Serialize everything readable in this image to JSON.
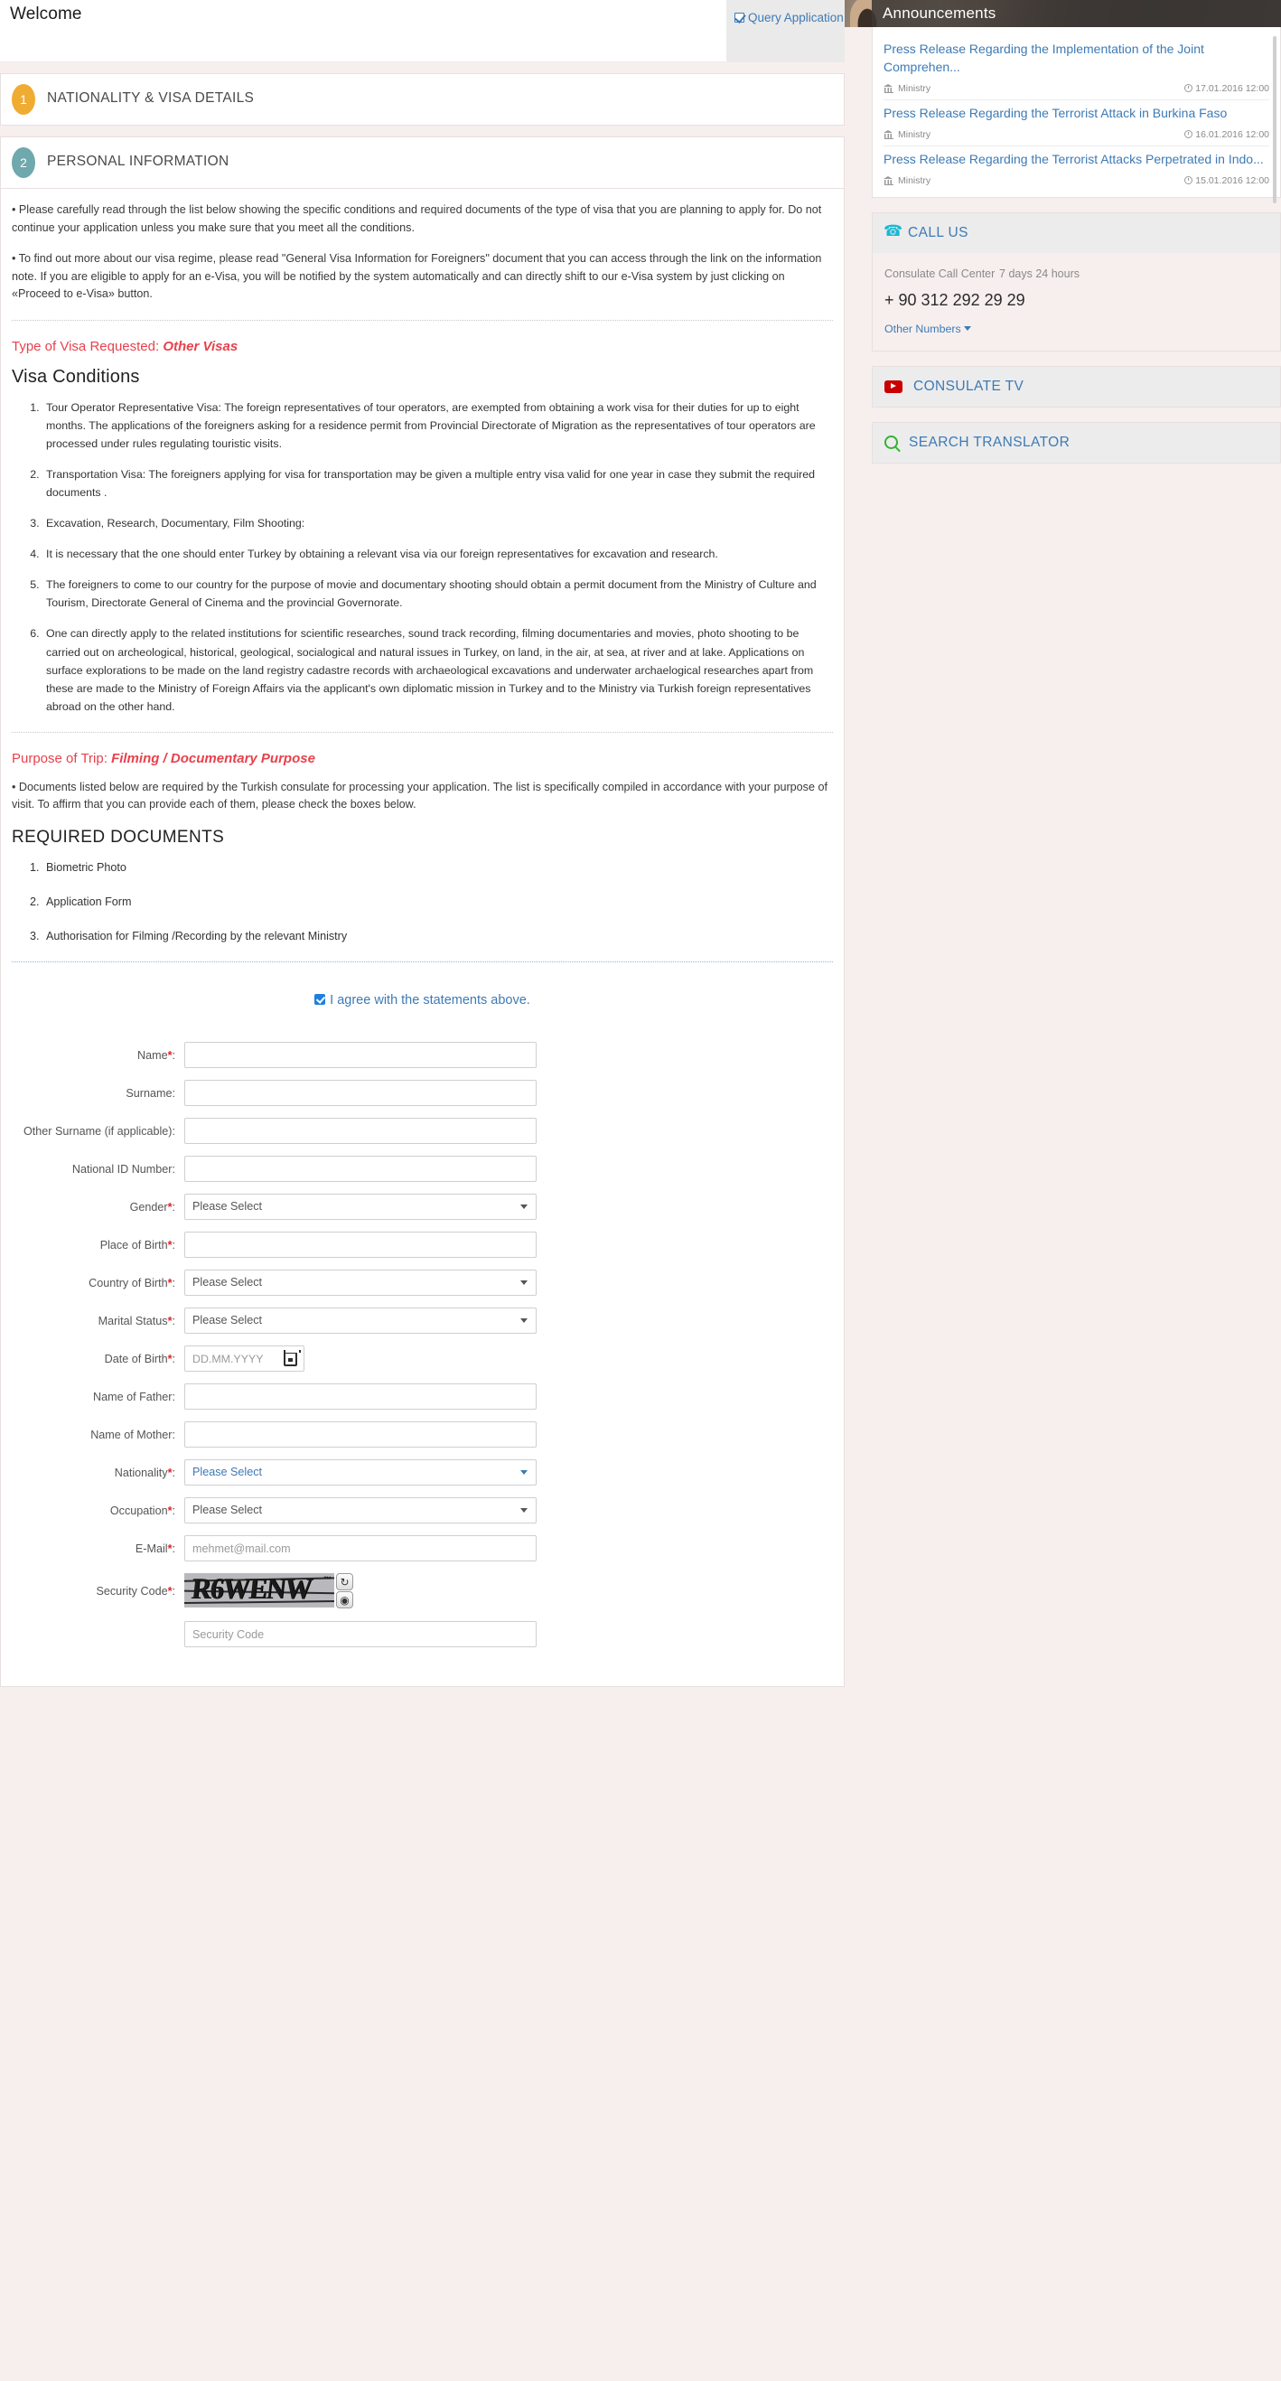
{
  "header": {
    "welcome": "Welcome",
    "query_tab": "Query Application"
  },
  "steps": [
    {
      "num": "1",
      "label": "NATIONALITY & VISA DETAILS",
      "color": "#f0ab33"
    },
    {
      "num": "2",
      "label": "PERSONAL INFORMATION",
      "color": "#6fa8ad"
    }
  ],
  "notes": {
    "note1": "• Please carefully read through the list below showing the specific conditions and required documents of the type of visa that you are planning to apply for. Do not continue your application unless you make sure that you meet all the conditions.",
    "note2": "• To find out more about our visa regime, please read \"General Visa Information for Foreigners\" document that you can access through the link on the information note. If you are eligible to apply for an e-Visa, you will be notified by the system automatically and can directly shift to our e-Visa system by just clicking on «Proceed to e-Visa» button.",
    "note3": "• Documents listed below are required by the Turkish consulate for processing your application. The list is specifically compiled in accordance with your purpose of visit. To affirm that you can provide each of them, please check the boxes below."
  },
  "visa_type": {
    "label": "Type of Visa Requested:",
    "value": "Other Visas"
  },
  "purpose": {
    "label": "Purpose of Trip:",
    "value": "Filming / Documentary Purpose"
  },
  "visa_conditions": {
    "heading": "Visa Conditions",
    "items": [
      "Tour Operator Representative Visa: The foreign representatives of tour operators, are exempted from obtaining a work visa for their duties for up to eight months. The applications of the foreigners asking for a residence permit from Provincial Directorate of Migration as the representatives of tour operators are processed under rules regulating touristic visits.",
      "Transportation Visa: The foreigners applying for visa for transportation may be given a multiple entry visa valid for one year in case they submit the required documents .",
      "Excavation, Research, Documentary, Film Shooting:",
      "It is necessary that the one should enter Turkey by obtaining a relevant visa via our foreign representatives for excavation and research.",
      "The foreigners to come to our country for the purpose of movie and documentary shooting should obtain a permit document from the Ministry of Culture and Tourism, Directorate General of Cinema and the provincial Governorate.",
      "One can directly apply to the related institutions for scientific researches, sound track recording, filming documentaries and movies, photo shooting to be carried out on archeological, historical, geological, socialogical and natural issues in Turkey, on land, in the air, at sea, at river and at lake. Applications on surface explorations to be made on the land registry cadastre records with archaeological excavations and underwater archaelogical researches apart from these are made to the Ministry of Foreign Affairs via the applicant's own diplomatic mission in Turkey and to the Ministry via Turkish foreign representatives abroad on the other hand."
    ]
  },
  "required_documents": {
    "heading": "REQUIRED DOCUMENTS",
    "items": [
      "Biometric Photo",
      "Application Form",
      "Authorisation for Filming /Recording by the relevant Ministry"
    ]
  },
  "agreement": {
    "text": "I agree with the statements above.",
    "checked": true
  },
  "form": {
    "fields": [
      {
        "label": "Name",
        "required": true,
        "type": "text",
        "value": "",
        "placeholder": ""
      },
      {
        "label": "Surname",
        "required": false,
        "type": "text",
        "value": "",
        "placeholder": ""
      },
      {
        "label": "Other Surname (if applicable)",
        "required": false,
        "type": "text",
        "value": "",
        "placeholder": ""
      },
      {
        "label": "National ID Number",
        "required": false,
        "type": "text",
        "value": "",
        "placeholder": ""
      },
      {
        "label": "Gender",
        "required": true,
        "type": "select",
        "value": "Please Select"
      },
      {
        "label": "Place of Birth",
        "required": true,
        "type": "text",
        "value": "",
        "placeholder": ""
      },
      {
        "label": "Country of Birth",
        "required": true,
        "type": "select",
        "value": "Please Select"
      },
      {
        "label": "Marital Status",
        "required": true,
        "type": "select",
        "value": "Please Select"
      },
      {
        "label": "Date of Birth",
        "required": true,
        "type": "date",
        "value": "",
        "placeholder": "DD.MM.YYYY"
      },
      {
        "label": "Name of Father",
        "required": false,
        "type": "text",
        "value": "",
        "placeholder": ""
      },
      {
        "label": "Name of Mother",
        "required": false,
        "type": "text",
        "value": "",
        "placeholder": ""
      },
      {
        "label": "Nationality",
        "required": true,
        "type": "select",
        "value": "Please Select",
        "highlight": true
      },
      {
        "label": "Occupation",
        "required": true,
        "type": "select",
        "value": "Please Select"
      },
      {
        "label": "E-Mail",
        "required": true,
        "type": "text",
        "value": "",
        "placeholder": "mehmet@mail.com"
      },
      {
        "label": "Security Code",
        "required": true,
        "type": "captcha",
        "captcha_text": "R6WENW"
      }
    ],
    "security_code_input_placeholder": "Security Code"
  },
  "announcements": {
    "heading": "Announcements",
    "items": [
      {
        "title": "Press Release Regarding the Implementation of the Joint Comprehen...",
        "source": "Ministry",
        "date": "17.01.2016 12:00"
      },
      {
        "title": "Press Release Regarding the Terrorist Attack in Burkina Faso",
        "source": "Ministry",
        "date": "16.01.2016 12:00"
      },
      {
        "title": "Press Release Regarding the Terrorist Attacks Perpetrated in Indo...",
        "source": "Ministry",
        "date": "15.01.2016 12:00"
      }
    ]
  },
  "call_us": {
    "heading": "CALL US",
    "center_name": "Consulate Call Center",
    "hours": "7 days 24 hours",
    "phone": "+ 90 312 292 29 29",
    "other_numbers": "Other Numbers"
  },
  "consulate_tv": {
    "heading": "CONSULATE TV"
  },
  "search_translator": {
    "heading": "SEARCH TRANSLATOR"
  },
  "colors": {
    "accent_blue": "#3d7ab5",
    "red": "#e8414c",
    "step1": "#f0ab33",
    "step2": "#6fa8ad",
    "page_bg": "#f7efee"
  }
}
